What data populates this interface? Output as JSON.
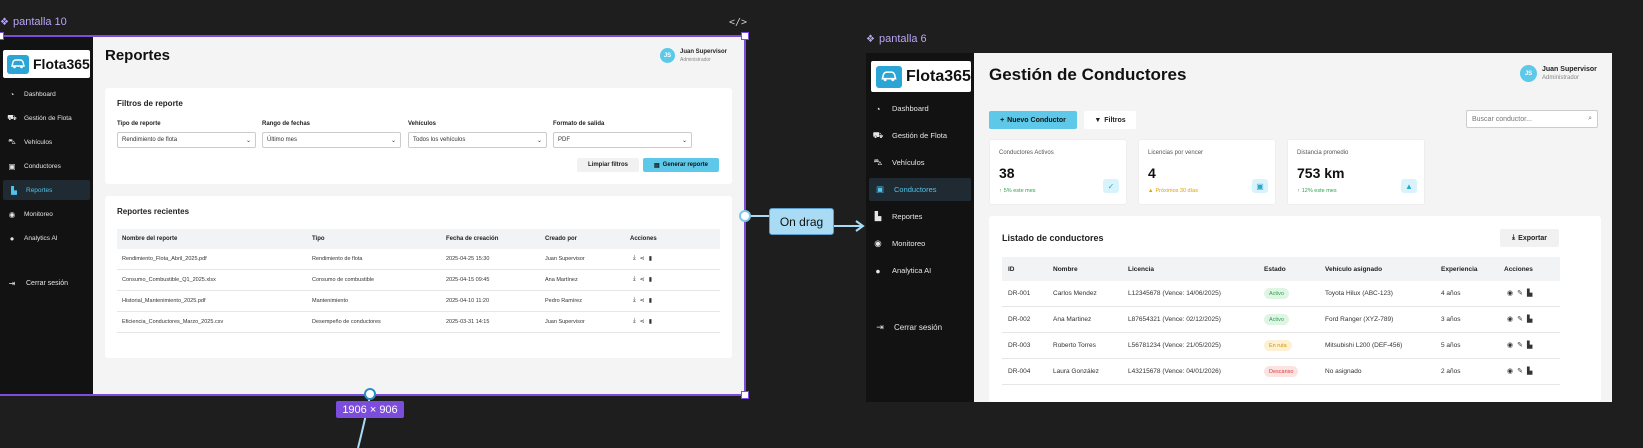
{
  "canvas": {
    "frame1_label": "pantalla 10",
    "frame2_label": "pantalla 6",
    "code_tag": "</>",
    "interaction_label": "On drag",
    "dimensions_label": "1906 × 906"
  },
  "colors": {
    "accent": "#5ec8e8",
    "selection": "#7c4ddd",
    "sidebar": "#121212"
  },
  "reportes": {
    "brand": "Flota365",
    "nav": [
      {
        "label": "Dashboard",
        "icon": "dashboard-icon"
      },
      {
        "label": "Gestión de Flota",
        "icon": "truck-icon"
      },
      {
        "label": "Vehículos",
        "icon": "car-icon"
      },
      {
        "label": "Conductores",
        "icon": "id-card-icon"
      },
      {
        "label": "Reportes",
        "icon": "chart-icon"
      },
      {
        "label": "Monitoreo",
        "icon": "eye-icon"
      },
      {
        "label": "Analytics AI",
        "icon": "brain-icon"
      }
    ],
    "logout": "Cerrar sesión",
    "title": "Reportes",
    "user": {
      "initials": "JS",
      "name": "Juan Supervisor",
      "role": "Administrador"
    },
    "filters": {
      "title": "Filtros de reporte",
      "fields": [
        {
          "label": "Tipo de reporte",
          "value": "Rendimiento de flota"
        },
        {
          "label": "Rango de fechas",
          "value": "Último mes"
        },
        {
          "label": "Vehículos",
          "value": "Todos los vehículos"
        },
        {
          "label": "Formato de salida",
          "value": "PDF"
        }
      ],
      "clear_label": "Limpiar filtros",
      "generate_label": "Generar reporte"
    },
    "recent": {
      "title": "Reportes recientes",
      "columns": [
        "Nombre del reporte",
        "Tipo",
        "Fecha de creación",
        "Creado por",
        "Acciones"
      ],
      "rows": [
        [
          "Rendimiento_Flota_Abril_2025.pdf",
          "Rendimiento de flota",
          "2025-04-25 15:30",
          "Juan Supervisor"
        ],
        [
          "Consumo_Combustible_Q1_2025.xlsx",
          "Consumo de combustible",
          "2025-04-15 09:45",
          "Ana Martínez"
        ],
        [
          "Historial_Mantenimiento_2025.pdf",
          "Mantenimiento",
          "2025-04-10 11:20",
          "Pedro Ramírez"
        ],
        [
          "Eficiencia_Conductores_Marzo_2025.csv",
          "Desempeño de conductores",
          "2025-03-31 14:15",
          "Juan Supervisor"
        ]
      ]
    }
  },
  "conductores": {
    "brand": "Flota365",
    "nav": [
      {
        "label": "Dashboard",
        "icon": "dashboard-icon"
      },
      {
        "label": "Gestión de Flota",
        "icon": "truck-icon"
      },
      {
        "label": "Vehículos",
        "icon": "car-icon"
      },
      {
        "label": "Conductores",
        "icon": "id-card-icon"
      },
      {
        "label": "Reportes",
        "icon": "chart-icon"
      },
      {
        "label": "Monitoreo",
        "icon": "eye-icon"
      },
      {
        "label": "Analytica AI",
        "icon": "brain-icon"
      }
    ],
    "logout": "Cerrar sesión",
    "title": "Gestión de Conductores",
    "user": {
      "initials": "JS",
      "name": "Juan Supervisor",
      "role": "Administrador"
    },
    "new_button": "Nuevo Conductor",
    "filters_button": "Filtros",
    "search_placeholder": "Buscar conductor...",
    "stats": [
      {
        "label": "Conductores Activos",
        "value": "38",
        "sub": "5% este mes",
        "sub_color": "#2e9e4f",
        "icon": "user-check-icon"
      },
      {
        "label": "Licencias por vencer",
        "value": "4",
        "sub": "Próximos 30 días",
        "sub_color": "#e0a100",
        "icon": "id-card-icon"
      },
      {
        "label": "Distancia promedio",
        "value": "753 km",
        "sub": "12% este mes",
        "sub_color": "#2e9e4f",
        "icon": "road-icon"
      }
    ],
    "list": {
      "title": "Listado de conductores",
      "export_label": "Exportar",
      "columns": [
        "ID",
        "Nombre",
        "Licencia",
        "Estado",
        "Vehículo asignado",
        "Experiencia",
        "Acciones"
      ],
      "rows": [
        {
          "id": "DR-001",
          "name": "Carlos Mendez",
          "license": "L12345678 (Vence: 14/06/2025)",
          "status": "Activo",
          "status_bg": "#dff5e4",
          "status_fg": "#2e9e4f",
          "vehicle": "Toyota Hilux (ABC-123)",
          "exp": "4 años"
        },
        {
          "id": "DR-002",
          "name": "Ana Martinez",
          "license": "L87654321 (Vence: 02/12/2025)",
          "status": "Activo",
          "status_bg": "#dff5e4",
          "status_fg": "#2e9e4f",
          "vehicle": "Ford Ranger (XYZ-789)",
          "exp": "3 años"
        },
        {
          "id": "DR-003",
          "name": "Roberto Torres",
          "license": "L56781234 (Vence: 21/05/2025)",
          "status": "En ruta",
          "status_bg": "#fdf1d4",
          "status_fg": "#d69100",
          "vehicle": "Mitsubishi L200 (DEF-456)",
          "exp": "5 años"
        },
        {
          "id": "DR-004",
          "name": "Laura González",
          "license": "L43215678 (Vence: 04/01/2026)",
          "status": "Descanso",
          "status_bg": "#fde2e2",
          "status_fg": "#d84040",
          "vehicle": "No asignado",
          "exp": "2 años"
        }
      ]
    }
  }
}
